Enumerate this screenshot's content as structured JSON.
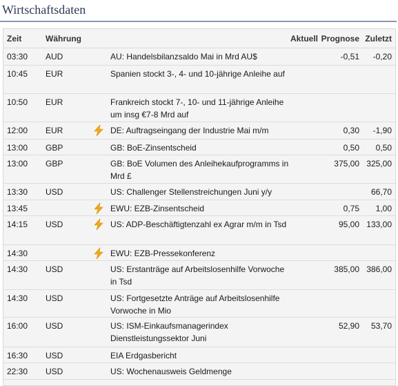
{
  "title": "Wirtschaftsdaten",
  "columns": {
    "zeit": "Zeit",
    "waehrung": "Währung",
    "aktuell": "Aktuell",
    "prognose": "Prognose",
    "zuletzt": "Zuletzt"
  },
  "colors": {
    "title": "#2b3a55",
    "rule": "#8a98ad",
    "panel": "#f4f4f4",
    "bolt": "#f0a81c"
  },
  "rows": [
    {
      "time": "03:30",
      "currency": "AUD",
      "important": false,
      "desc": "AU: Handelsbilanzsaldo Mai in Mrd AU$",
      "aktuell": "",
      "prognose": "-0,51",
      "zuletzt": "-0,20"
    },
    {
      "time": "10:45",
      "currency": "EUR",
      "important": false,
      "desc": "Spanien stockt 3-, 4- und 10-jährige Anleihe auf",
      "aktuell": "",
      "prognose": "",
      "zuletzt": ""
    },
    {
      "time": "10:50",
      "currency": "EUR",
      "important": false,
      "desc": "Frankreich stockt 7-, 10- und 11-jährige Anleihe um insg €7-8 Mrd auf",
      "aktuell": "",
      "prognose": "",
      "zuletzt": ""
    },
    {
      "time": "12:00",
      "currency": "EUR",
      "important": true,
      "desc": "DE: Auftragseingang der Industrie Mai m/m",
      "aktuell": "",
      "prognose": "0,30",
      "zuletzt": "-1,90"
    },
    {
      "time": "13:00",
      "currency": "GBP",
      "important": false,
      "desc": "GB: BoE-Zinsentscheid",
      "aktuell": "",
      "prognose": "0,50",
      "zuletzt": "0,50"
    },
    {
      "time": "13:00",
      "currency": "GBP",
      "important": false,
      "desc": "GB: BoE Volumen des Anleihekaufprogramms in Mrd £",
      "aktuell": "",
      "prognose": "375,00",
      "zuletzt": "325,00"
    },
    {
      "time": "13:30",
      "currency": "USD",
      "important": false,
      "desc": "US: Challenger Stellenstreichungen Juni y/y",
      "aktuell": "",
      "prognose": "",
      "zuletzt": "66,70"
    },
    {
      "time": "13:45",
      "currency": "",
      "important": true,
      "desc": "EWU: EZB-Zinsentscheid",
      "aktuell": "",
      "prognose": "0,75",
      "zuletzt": "1,00"
    },
    {
      "time": "14:15",
      "currency": "USD",
      "important": true,
      "desc": "US: ADP-Beschäftigtenzahl ex Agrar m/m in Tsd",
      "aktuell": "",
      "prognose": "95,00",
      "zuletzt": "133,00"
    },
    {
      "time": "14:30",
      "currency": "",
      "important": true,
      "desc": "EWU: EZB-Pressekonferenz",
      "aktuell": "",
      "prognose": "",
      "zuletzt": ""
    },
    {
      "time": "14:30",
      "currency": "USD",
      "important": false,
      "desc": "US: Erstanträge auf Arbeitslosenhilfe Vorwoche in Tsd",
      "aktuell": "",
      "prognose": "385,00",
      "zuletzt": "386,00"
    },
    {
      "time": "14:30",
      "currency": "USD",
      "important": false,
      "desc": "US: Fortgesetzte Anträge auf Arbeitslosenhilfe Vorwoche in Mio",
      "aktuell": "",
      "prognose": "",
      "zuletzt": ""
    },
    {
      "time": "16:00",
      "currency": "USD",
      "important": false,
      "desc": "US: ISM-Einkaufsmanagerindex Dienstleistungssektor Juni",
      "aktuell": "",
      "prognose": "52,90",
      "zuletzt": "53,70"
    },
    {
      "time": "16:30",
      "currency": "USD",
      "important": false,
      "desc": "EIA Erdgasbericht",
      "aktuell": "",
      "prognose": "",
      "zuletzt": ""
    },
    {
      "time": "22:30",
      "currency": "USD",
      "important": false,
      "desc": "US: Wochenausweis Geldmenge",
      "aktuell": "",
      "prognose": "",
      "zuletzt": ""
    }
  ]
}
